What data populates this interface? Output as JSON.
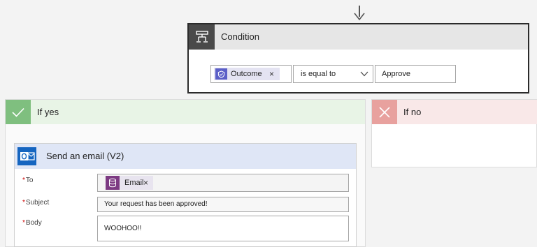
{
  "condition": {
    "title": "Condition",
    "operand_token": {
      "label": "Outcome",
      "remove": "×"
    },
    "operator": "is equal to",
    "value": "Approve"
  },
  "branches": {
    "yes": {
      "title": "If yes"
    },
    "no": {
      "title": "If no"
    }
  },
  "email_action": {
    "title": "Send an email (V2)",
    "to": {
      "label": "To",
      "required": "*",
      "token_label": "Email",
      "token_remove": "×"
    },
    "subject": {
      "label": "Subject",
      "required": "*",
      "value": "Your request has been approved!"
    },
    "body": {
      "label": "Body",
      "required": "*",
      "value": "WOOHOO!!"
    }
  },
  "colors": {
    "yes_accent": "#7fbf7f",
    "no_accent": "#e8a19e",
    "condition_icon": "#4a4a4a",
    "outlook_blue": "#1565c0",
    "token_purple": "#5b5fc7",
    "email_token_purple": "#7c3a82"
  },
  "icons": {
    "condition": "condition-icon",
    "outcome": "approval-icon",
    "yes": "checkmark-icon",
    "no": "close-icon",
    "email": "outlook-icon",
    "email_token": "database-icon"
  }
}
